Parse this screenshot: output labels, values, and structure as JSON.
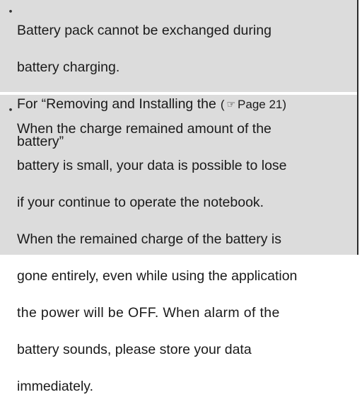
{
  "notes": [
    {
      "bullet": "・",
      "lines": [
        "Battery pack cannot be exchanged during",
        "battery charging.",
        "For “Removing and Installing the",
        "battery”"
      ],
      "page_ref": {
        "open": "(",
        "icon": "pointing-hand-icon",
        "icon_glyph": "☞",
        "label": "Page 21",
        "close": ")"
      }
    },
    {
      "bullet": "・",
      "lines": [
        "When the charge remained amount of the",
        "battery is small, your data is possible to lose",
        "if your continue to operate the notebook.",
        "When the remained charge of the battery is",
        "gone entirely, even while using the application",
        "the power will be OFF. When alarm of the",
        "battery sounds, please store your data",
        "immediately."
      ]
    }
  ],
  "colors": {
    "panel": "#dcdcdc",
    "text": "#1a1a1a",
    "rule": "#2a2a2a"
  }
}
